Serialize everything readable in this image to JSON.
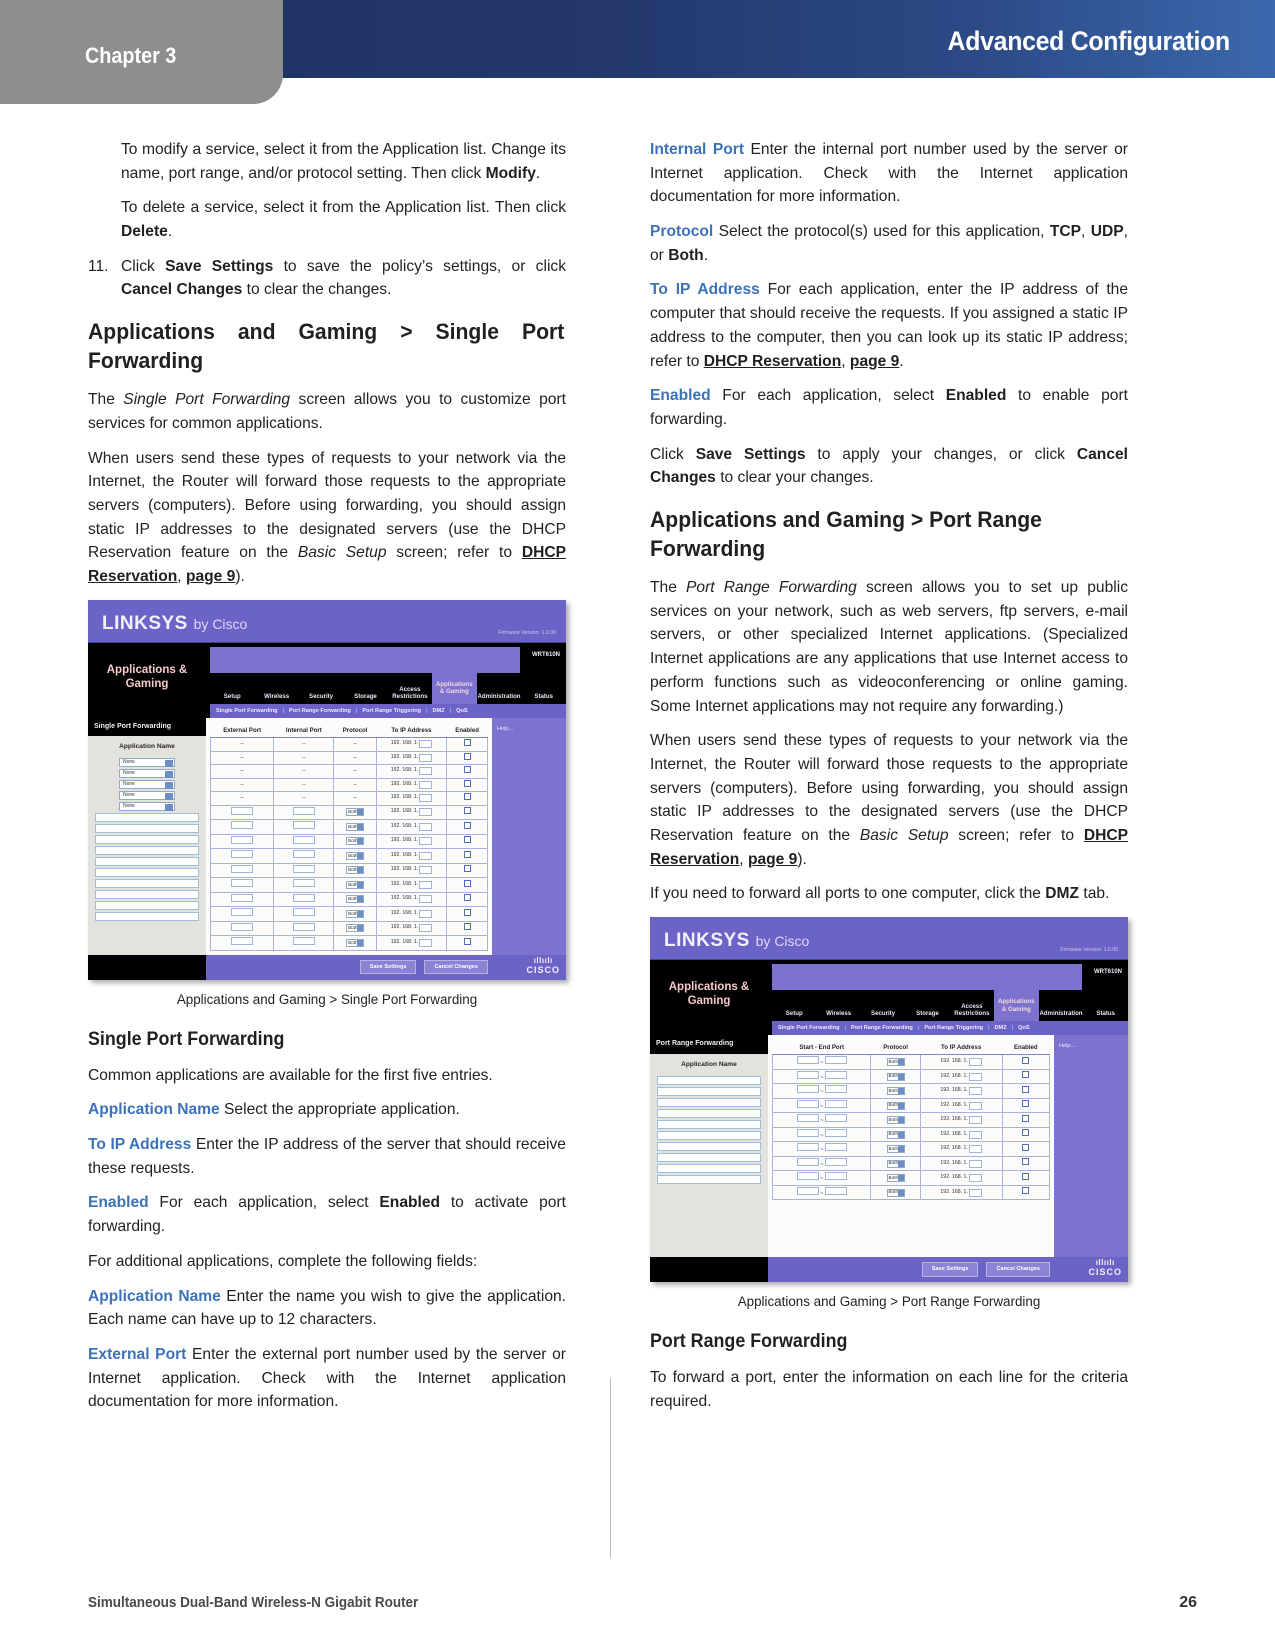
{
  "header": {
    "chapter": "Chapter 3",
    "title": "Advanced Configuration"
  },
  "footer": {
    "product": "Simultaneous Dual-Band Wireless-N Gigabit Router",
    "page_number": "26"
  },
  "left_column": {
    "para_modify": "To modify a service, select it from the Application list. Change its name, port range, and/or protocol setting. Then click ",
    "para_modify_bold": "Modify",
    "para_modify_end": ".",
    "para_delete": "To delete a service, select it from the Application list. Then click ",
    "para_delete_bold": "Delete",
    "para_delete_end": ".",
    "item11_num": "11.",
    "item11_a": "Click ",
    "item11_b1": "Save Settings",
    "item11_c": " to save the policy’s settings, or click ",
    "item11_b2": "Cancel Changes",
    "item11_d": " to clear the changes.",
    "heading_single": "Applications and Gaming > Single Port Forwarding",
    "p1_a": "The ",
    "p1_i": "Single Port Forwarding",
    "p1_b": " screen allows you to customize port services for common applications.",
    "p2_a": "When users send these types of requests to your network via the Internet, the Router will forward those requests to the appropriate servers (computers). Before using forwarding, you should assign static IP addresses to the designated servers (use the DHCP Reservation feature on the ",
    "p2_i": "Basic Setup",
    "p2_b": " screen; refer to ",
    "p2_link1": "DHCP Reservation",
    "p2_c": ", ",
    "p2_link2": "page 9",
    "p2_d": ").",
    "figure_caption": "Applications and Gaming > Single Port Forwarding",
    "subheading": "Single Port Forwarding",
    "p3": "Common applications are available for the first five entries.",
    "t1_term": "Application Name",
    "t1_text": "  Select the appropriate application.",
    "t2_term": "To IP Address",
    "t2_text": " Enter the IP address of the server that should receive these requests.",
    "t3_term": "Enabled",
    "t3_a": "  For each application, select ",
    "t3_b": "Enabled",
    "t3_c": " to activate port forwarding.",
    "p4": "For additional applications, complete the following fields:",
    "t4_term": "Application Name",
    "t4_text": "  Enter the name you wish to give the application. Each name can have up to 12 characters.",
    "t5_term": "External Port",
    "t5_text": "  Enter the external port number used by the server or Internet application. Check with the Internet application documentation for more information."
  },
  "right_column": {
    "t6_term": "Internal Port",
    "t6_text": "  Enter the internal port number used by the server or Internet application. Check with the Internet application documentation for more information.",
    "t7_term": "Protocol",
    "t7_a": "  Select the protocol(s) used for this application, ",
    "t7_b1": "TCP",
    "t7_c1": ", ",
    "t7_b2": "UDP",
    "t7_c2": ", or ",
    "t7_b3": "Both",
    "t7_d": ".",
    "t8_term": "To IP Address",
    "t8_a": "  For each application, enter the IP address of the computer that should receive the requests. If you assigned a static IP address to the computer, then you can look up its static IP address; refer to ",
    "t8_link1": "DHCP Reservation",
    "t8_b": ", ",
    "t8_link2": "page 9",
    "t8_c": ".",
    "t9_term": "Enabled",
    "t9_a": "  For each application, select ",
    "t9_b": "Enabled",
    "t9_c": " to enable port forwarding.",
    "p5_a": "Click ",
    "p5_b1": "Save Settings",
    "p5_c": " to apply your changes, or click ",
    "p5_b2": "Cancel Changes",
    "p5_d": " to clear your changes.",
    "heading_range": "Applications and Gaming > Port Range Forwarding",
    "p6_a": "The ",
    "p6_i": "Port Range Forwarding",
    "p6_b": " screen allows you to set up public services on your network, such as web servers, ftp servers, e-mail servers, or other specialized Internet applications. (Specialized Internet applications are any applications that use Internet access to perform functions such as videoconferencing or online gaming. Some Internet applications may not require any forwarding.)",
    "p7_a": "When users send these types of requests to your network via the Internet, the Router will forward those requests to the appropriate servers (computers). Before using forwarding, you should assign static IP addresses to the designated servers (use the DHCP Reservation feature on the ",
    "p7_i": "Basic Setup",
    "p7_b": " screen; refer to ",
    "p7_link1": "DHCP Reservation",
    "p7_c": ", ",
    "p7_link2": "page 9",
    "p7_d": ").",
    "p8_a": "If you need to forward all ports to one computer, click the ",
    "p8_b": "DMZ",
    "p8_c": " tab.",
    "figure_caption": "Applications and Gaming > Port Range Forwarding",
    "subheading": "Port Range Forwarding",
    "p9": "To forward a port, enter the information on each line for the criteria required."
  },
  "router_ui": {
    "brand": "LINKSYS",
    "brand_suffix": "by Cisco",
    "firmware": "Firmware Version: 1.0.00",
    "model": "WRT610N",
    "side_title": "Applications & Gaming",
    "nav_tabs": [
      "Setup",
      "Wireless",
      "Security",
      "Storage",
      "Access Restrictions",
      "Applications & Gaming",
      "Administration",
      "Status"
    ],
    "active_tab": "Applications & Gaming",
    "sub_tabs": [
      "Single Port Forwarding",
      "Port Range Forwarding",
      "Port Range Triggering",
      "DMZ",
      "QoS"
    ],
    "help_label": "Help...",
    "save_button": "Save Settings",
    "cancel_button": "Cancel Changes",
    "cisco_logo": "CISCO",
    "single_port": {
      "pane_title": "Single Port Forwarding",
      "app_name_header": "Application Name",
      "columns": [
        "External Port",
        "Internal Port",
        "Protocol",
        "To IP Address",
        "Enabled"
      ],
      "app_select_value": "None",
      "preset_rows": 5,
      "custom_rows": 10,
      "ip_prefix": "192. 168. 1.",
      "ip_suffix": "0",
      "protocol_value": "Both",
      "dash": "--"
    },
    "port_range": {
      "pane_title": "Port Range Forwarding",
      "app_name_header": "Application Name",
      "columns": [
        "Start - End Port",
        "Protocol",
        "To IP Address",
        "Enabled"
      ],
      "rows": 10,
      "ip_prefix": "192. 168. 1.",
      "ip_suffix": "0",
      "protocol_value": "Both"
    }
  }
}
